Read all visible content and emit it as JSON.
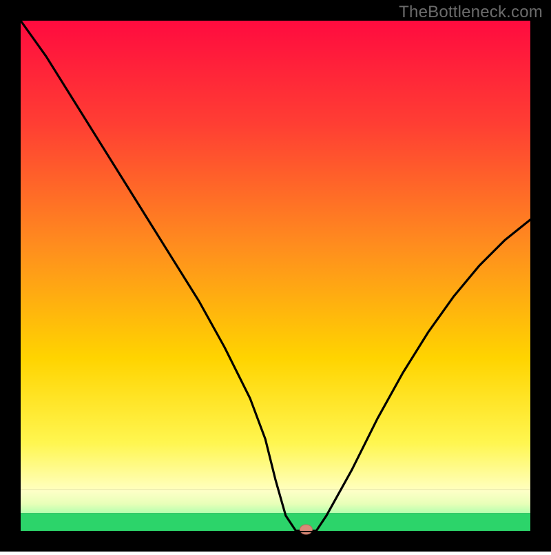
{
  "watermark": "TheBottleneck.com",
  "chart_data": {
    "type": "line",
    "title": "",
    "xlabel": "",
    "ylabel": "",
    "xlim": [
      0,
      100
    ],
    "ylim": [
      0,
      100
    ],
    "x": [
      0,
      5,
      10,
      15,
      20,
      25,
      30,
      35,
      40,
      45,
      48,
      50,
      52,
      54,
      56,
      58,
      60,
      65,
      70,
      75,
      80,
      85,
      90,
      95,
      100
    ],
    "values": [
      100,
      93,
      85,
      77,
      69,
      61,
      53,
      45,
      36,
      26,
      18,
      10,
      3,
      0,
      0,
      0,
      3,
      12,
      22,
      31,
      39,
      46,
      52,
      57,
      61
    ],
    "marker": {
      "x": 56,
      "y": 0
    },
    "bands": {
      "green_top_y": 3.5,
      "pale_band_top_y": 8
    }
  },
  "frame": {
    "border_px": 30,
    "inner": 740
  }
}
